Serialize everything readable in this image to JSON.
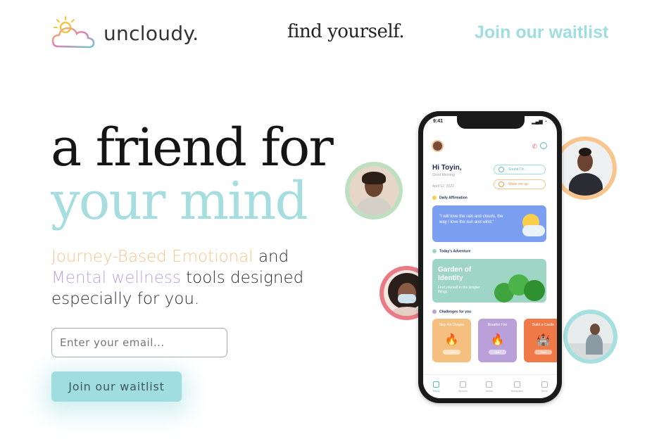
{
  "header": {
    "logo_text": "uncloudy.",
    "tagline": "find yourself.",
    "nav_cta": "Join our waitlist"
  },
  "hero": {
    "title_line1": "a friend for",
    "title_line2": "your mind",
    "subtitle_part1": "Journey-Based Emotional",
    "subtitle_part2": " and ",
    "subtitle_part3": "Mental wellness",
    "subtitle_part4": " tools designed especially for you."
  },
  "form": {
    "email_placeholder": "Enter your email...",
    "email_value": "",
    "submit_label": "Join our waitlist"
  },
  "phone": {
    "status_time": "9:41",
    "status_icons": "▂▄▆ ◔",
    "greeting": "Hi Toyin,",
    "greeting_sub": "Good Morning",
    "date": "April 12, 2022",
    "sound_on": "Sound On",
    "wake_me_up": "Wake me up",
    "daily_affirmation_label": "Daily Affirmation",
    "affirmation_text": "\"I will love the rain and clouds, the way I love the sun and wind.\"",
    "todays_adventure_label": "Today's Adventure",
    "adventure_title": "Garden of Identity",
    "adventure_sub": "Find yourself in the simpler things",
    "challenges_label": "Challenges for you",
    "challenges": [
      {
        "title": "Slay the Dragon",
        "icon": "🔥",
        "button": "Start"
      },
      {
        "title": "Breathe Fire",
        "icon": "🔥",
        "button": "Start"
      },
      {
        "title": "Build a Castle",
        "icon": "🏰",
        "button": "Start"
      }
    ],
    "tabs": [
      "Today",
      "Spaces",
      "News",
      "Backpack",
      "More"
    ]
  },
  "colors": {
    "teal": "#9fdde0",
    "orange": "#f7c58d",
    "purple": "#b9a6d8",
    "bubble_green": "#bfe0c0",
    "bubble_orange": "#f7c58d",
    "bubble_pink": "#e97a86",
    "bubble_teal": "#a6dfe0"
  }
}
